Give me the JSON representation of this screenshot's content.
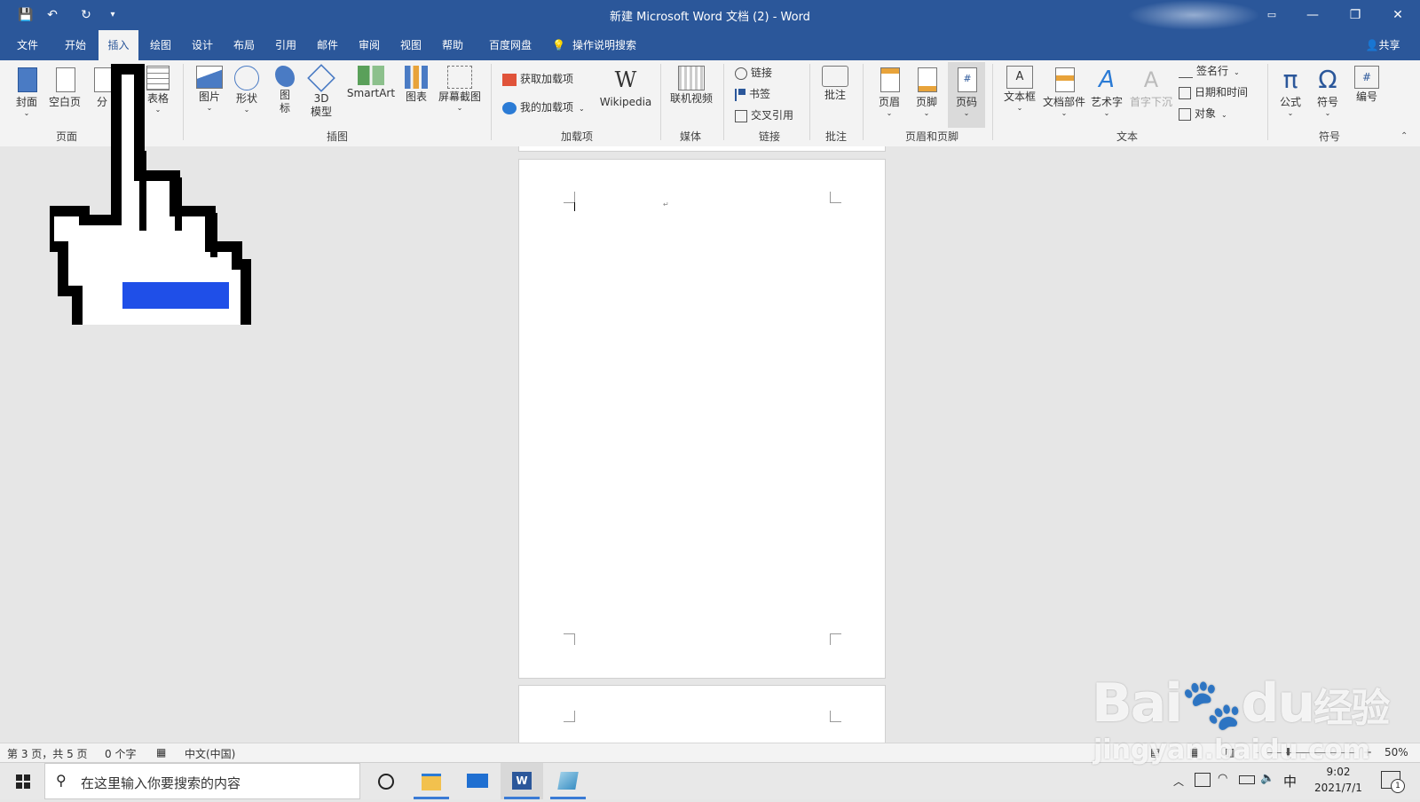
{
  "window": {
    "title": "新建 Microsoft Word 文档 (2)  -  Word",
    "minimize_glyph": "—",
    "restore_glyph": "❐",
    "close_glyph": "✕"
  },
  "quick_access": {
    "save": "💾",
    "undo": "↶",
    "redo": "↻",
    "customize": "▾"
  },
  "tabs": [
    "文件",
    "开始",
    "插入",
    "绘图",
    "设计",
    "布局",
    "引用",
    "邮件",
    "审阅",
    "视图",
    "帮助",
    "百度网盘"
  ],
  "active_tab_index": 2,
  "tell_me": "操作说明搜索",
  "share": "共享",
  "ribbon": {
    "pages": {
      "cover": "封面",
      "blank": "空白页",
      "break": "分",
      "table": "表格",
      "group": "页面"
    },
    "illustrations": {
      "picture": "图片",
      "shapes": "形状",
      "icons_l1": "图",
      "icons_l2": "标",
      "model_l1": "3D",
      "model_l2": "模型",
      "smartart": "SmartArt",
      "chart": "图表",
      "screenshot": "屏幕截图",
      "group": "插图"
    },
    "addins": {
      "get": "获取加载项",
      "my": "我的加载项",
      "wiki": "Wikipedia",
      "wiki_glyph": "W",
      "group": "加载项"
    },
    "media": {
      "video": "联机视频",
      "group": "媒体"
    },
    "links": {
      "link": "链接",
      "bookmark": "书签",
      "crossref": "交叉引用",
      "group": "链接"
    },
    "comments": {
      "comment": "批注",
      "group": "批注"
    },
    "header_footer": {
      "header": "页眉",
      "footer": "页脚",
      "page_number": "页码",
      "group": "页眉和页脚"
    },
    "text": {
      "textbox": "文本框",
      "quickparts": "文档部件",
      "wordart": "艺术字",
      "dropcap": "首字下沉",
      "signature": "签名行",
      "datetime": "日期和时间",
      "object": "对象",
      "group": "文本"
    },
    "symbols": {
      "equation": "公式",
      "equation_glyph": "π",
      "symbol": "符号",
      "symbol_glyph": "Ω",
      "number": "编号",
      "group": "符号"
    }
  },
  "status": {
    "page": "第 3 页，共 5 页",
    "words": "0 个字",
    "language": "中文(中国)",
    "zoom": "50%",
    "zoom_minus": "-",
    "zoom_plus": "+"
  },
  "taskbar": {
    "search_placeholder": "在这里输入你要搜索的内容",
    "time": "9:02",
    "date": "2021/7/1",
    "ime": "中",
    "notification_count": "1"
  },
  "watermark": {
    "brand": "Bai",
    "brand_suffix": "du",
    "cn": "经验",
    "url": "jingyan.baidu.com"
  },
  "colors": {
    "accent": "#2b579a",
    "ribbon_bg": "#f3f3f3",
    "canvas_bg": "#e6e6e6"
  }
}
